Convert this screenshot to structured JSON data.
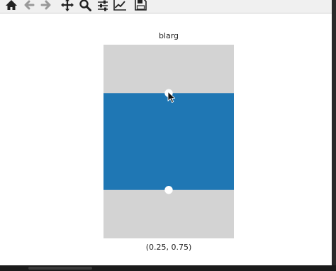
{
  "toolbar": {
    "buttons": [
      {
        "name": "home-icon"
      },
      {
        "name": "back-arrow-icon"
      },
      {
        "name": "forward-arrow-icon"
      },
      {
        "name": "pan-icon"
      },
      {
        "name": "zoom-icon"
      },
      {
        "name": "configure-subplots-icon"
      },
      {
        "name": "edit-axis-icon"
      },
      {
        "name": "save-icon"
      }
    ]
  },
  "figure": {
    "title": "blarg",
    "coordinate_readout": "(0.25, 0.75)"
  },
  "colors": {
    "axes_background": "#d3d3d3",
    "span_fill": "#1f77b4",
    "handle_fill": "#ffffff"
  },
  "span_selector": {
    "y_range": [
      0,
      1
    ],
    "span_min": 0.25,
    "span_max": 0.75,
    "handles": [
      "lower",
      "upper"
    ]
  }
}
